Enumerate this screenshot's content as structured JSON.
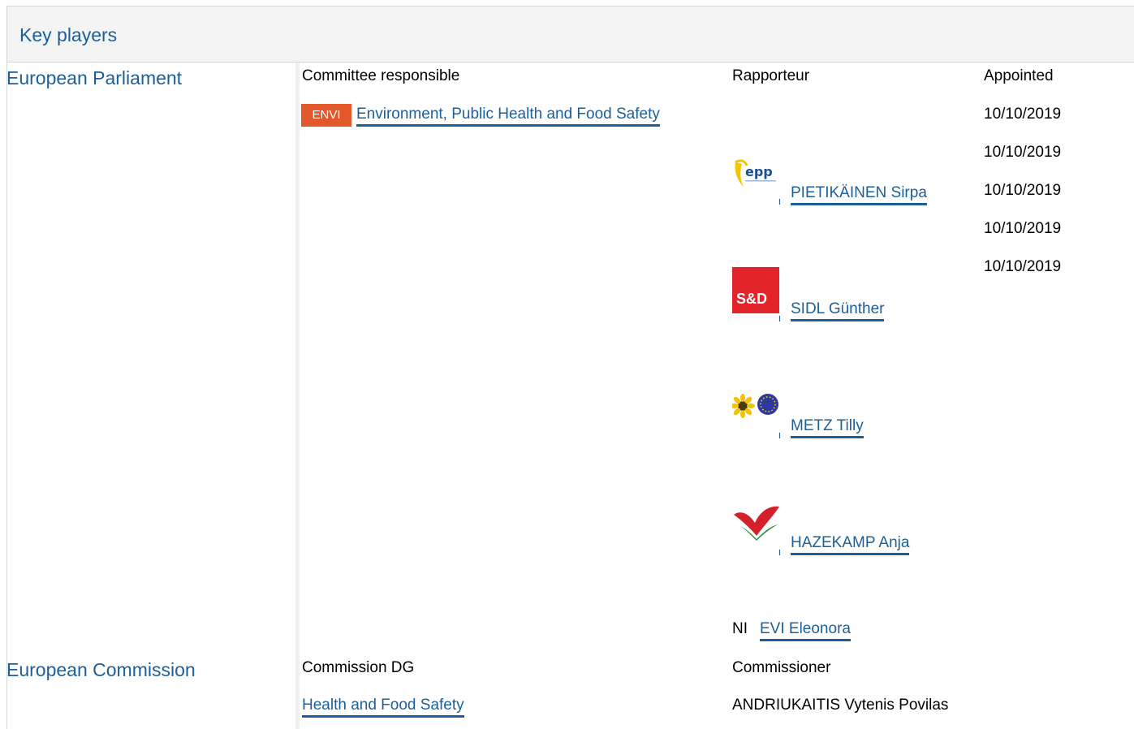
{
  "header": {
    "title": "Key players"
  },
  "parliament": {
    "label": "European Parliament",
    "col_committee": "Committee responsible",
    "col_rapporteur": "Rapporteur",
    "col_appointed": "Appointed",
    "committee": {
      "badge": "ENVI",
      "badge_color": "#e2582a",
      "name": "Environment, Public Health and Food Safety"
    },
    "dates": [
      "10/10/2019",
      "10/10/2019",
      "10/10/2019",
      "10/10/2019",
      "10/10/2019"
    ],
    "rapporteurs": [
      {
        "name": "PIETIKÄINEN Sirpa",
        "icon": "epp-logo-icon"
      },
      {
        "name": "SIDL Günther",
        "icon": "sd-logo-icon",
        "logo_text": "S&D"
      },
      {
        "name": "METZ Tilly",
        "icon": "greens-efa-logo-icon"
      },
      {
        "name": "HAZEKAMP Anja",
        "icon": "gue-ngl-logo-icon"
      },
      {
        "name": "EVI Eleonora",
        "group_label": "NI"
      }
    ]
  },
  "commission": {
    "label": "European Commission",
    "col_dg": "Commission DG",
    "col_commissioner": "Commissioner",
    "dg": "Health and Food Safety",
    "commissioner": "ANDRIUKAITIS Vytenis Povilas"
  },
  "colors": {
    "link": "#1d5f9a",
    "header_bg": "#f4f4f4"
  }
}
